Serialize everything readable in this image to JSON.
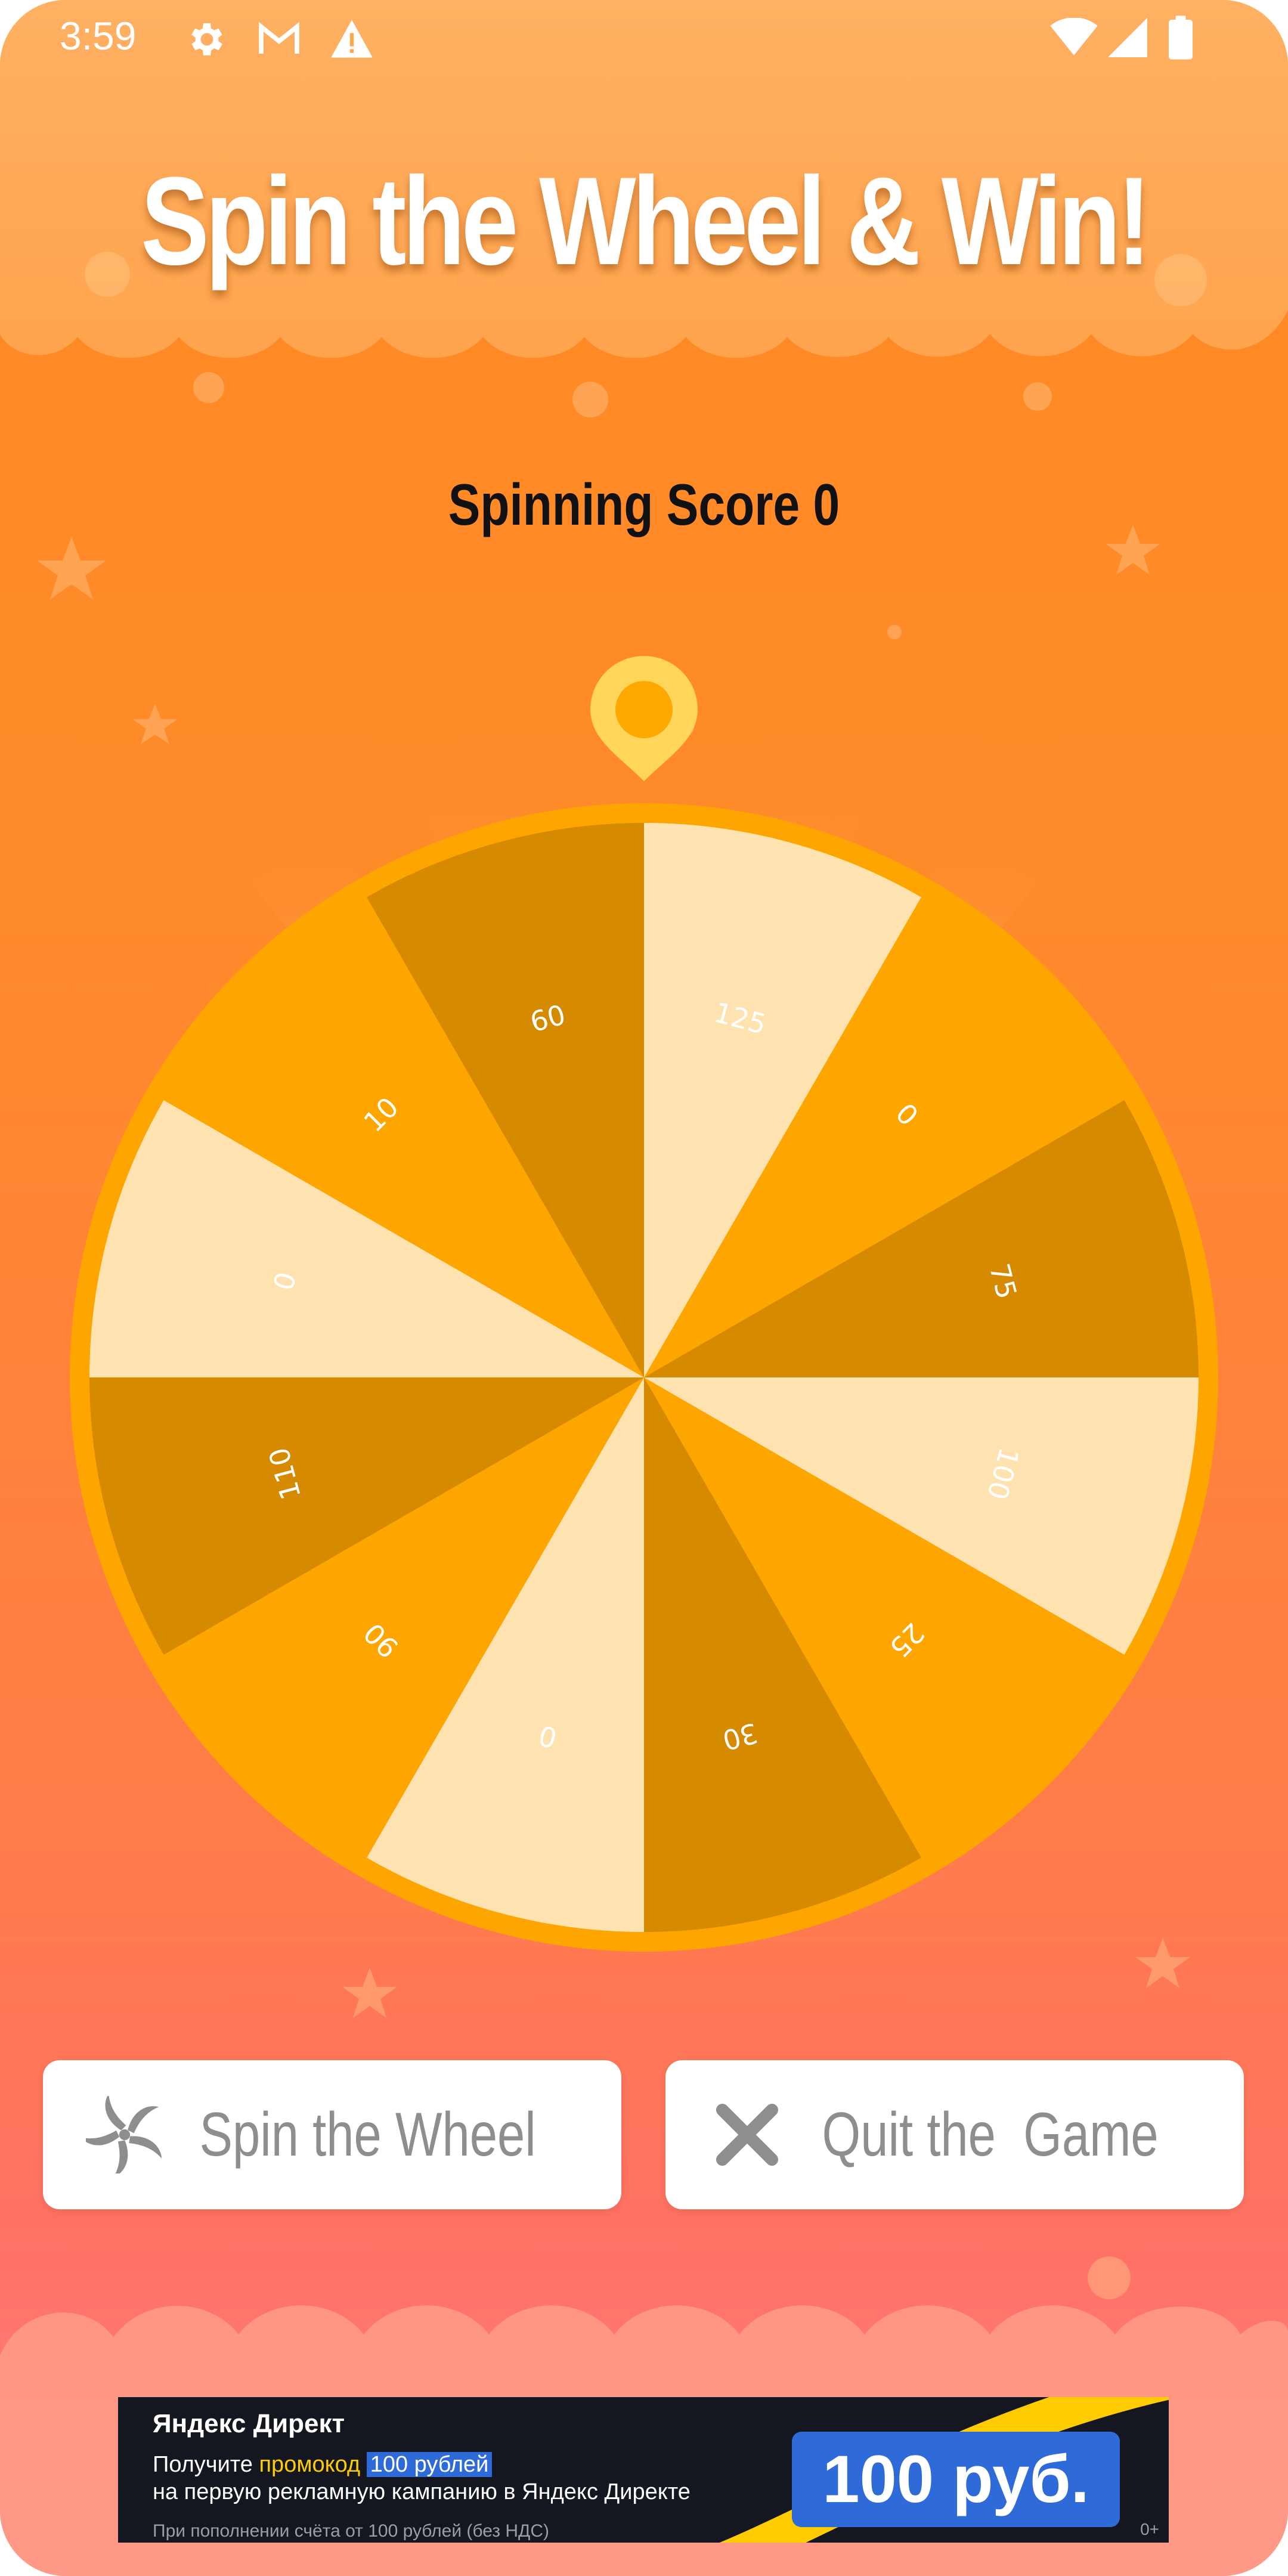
{
  "status_bar": {
    "time": "3:59",
    "icons": [
      "gear-icon",
      "gmail-icon",
      "warning-icon",
      "wifi-icon",
      "signal-icon",
      "battery-icon"
    ]
  },
  "title": "Spin the Wheel & Win!",
  "score": {
    "label": "Spinning Score",
    "value": "0"
  },
  "wheel": {
    "segments": [
      {
        "label": "125",
        "color": "#fee3b1"
      },
      {
        "label": "0",
        "color": "#fea500"
      },
      {
        "label": "75",
        "color": "#d58a00"
      },
      {
        "label": "100",
        "color": "#fee3b1"
      },
      {
        "label": "25",
        "color": "#fea500"
      },
      {
        "label": "30",
        "color": "#d58a00"
      },
      {
        "label": "0",
        "color": "#fee3b1"
      },
      {
        "label": "90",
        "color": "#fea500"
      },
      {
        "label": "110",
        "color": "#d58a00"
      },
      {
        "label": "0",
        "color": "#fee3b1"
      },
      {
        "label": "10",
        "color": "#fea500"
      },
      {
        "label": "60",
        "color": "#d58a00"
      }
    ],
    "rim_color": "#fea500",
    "pointer_icon": "map-pin-icon"
  },
  "buttons": {
    "spin": {
      "label": "Spin the Wheel",
      "icon": "pinwheel-icon"
    },
    "quit": {
      "label": "Quit the  Game",
      "icon": "close-icon"
    }
  },
  "ad": {
    "brand": "Яндекс Директ",
    "line1_prefix": "Получите ",
    "line1_promo": "промокод",
    "line1_highlight": "100 рублей",
    "line2": "на первую рекламную кампанию в Яндекс Директе",
    "small_print": "При пополнении счёта от 100 рублей (без НДС)",
    "price": "100 руб.",
    "age": "0+"
  },
  "colors": {
    "background_top": "#ffa64a",
    "background_bottom": "#ff8b86",
    "title_text": "#ffffff",
    "button_text": "#8e8e8e"
  }
}
